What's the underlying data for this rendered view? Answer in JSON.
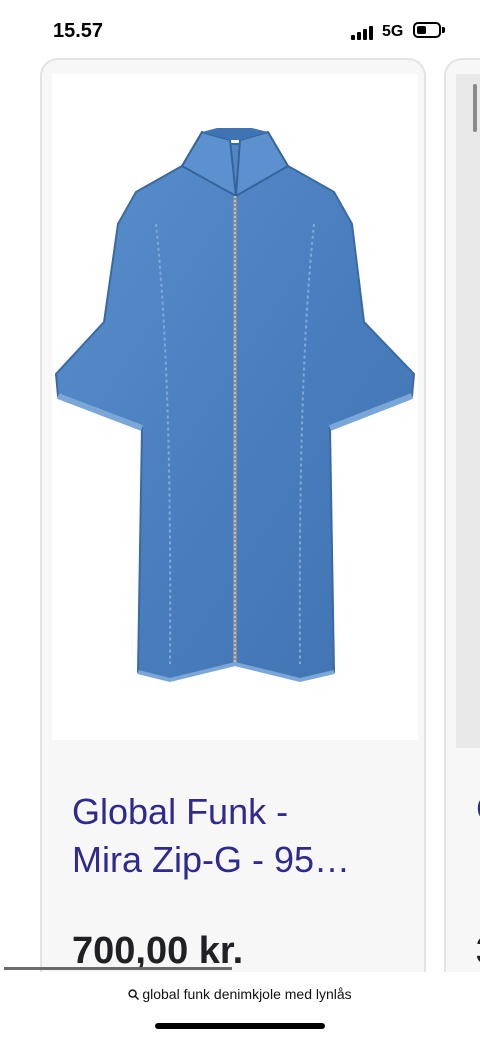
{
  "status_bar": {
    "time": "15.57",
    "network": "5G",
    "signal_icon": "cellular-signal-icon",
    "battery_icon": "battery-icon"
  },
  "product_card": {
    "image_alt": "denim zip dress",
    "title_line1": "Global Funk -",
    "title_line2": "Mira Zip-G - 95…",
    "price": "700,00 kr."
  },
  "next_card": {
    "title_partial": "C",
    "price_partial": "3"
  },
  "toolbar": {
    "search_icon": "magnifier-icon",
    "url_text": "global funk denimkjole med lynlås"
  },
  "colors": {
    "title_color": "#2e2a8f",
    "denim": "#4a7fbf",
    "card_bg": "#f7f7f7"
  }
}
